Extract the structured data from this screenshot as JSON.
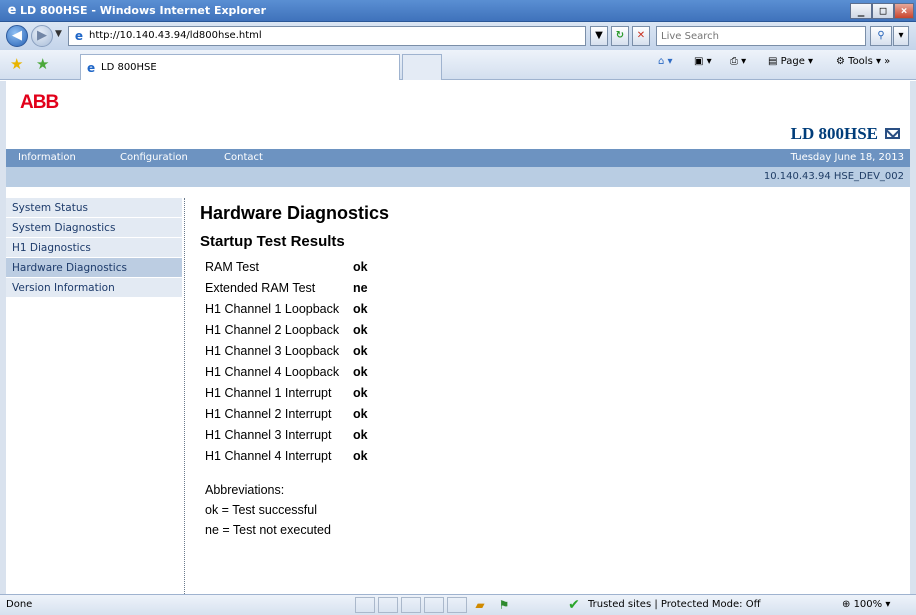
{
  "window": {
    "title": "LD 800HSE - Windows Internet Explorer",
    "minimize_label": "_",
    "maximize_label": "□",
    "close_label": "×"
  },
  "address_bar": {
    "url": "http://10.140.43.94/ld800hse.html",
    "search_placeholder": "Live Search"
  },
  "favorites_bar": {
    "tab_label": "LD 800HSE",
    "page_menu": "Page",
    "tools_menu": "Tools"
  },
  "page": {
    "logo": "ABB",
    "product_title": "LD 800HSE",
    "menu": [
      "Information",
      "Configuration",
      "Contact"
    ],
    "date": "Tuesday June 18, 2013",
    "host_info": "10.140.43.94 HSE_DEV_002",
    "sidebar": [
      {
        "label": "System Status"
      },
      {
        "label": "System Diagnostics"
      },
      {
        "label": "H1 Diagnostics"
      },
      {
        "label": "Hardware Diagnostics",
        "active": true
      },
      {
        "label": "Version Information"
      }
    ],
    "heading": "Hardware Diagnostics",
    "subheading": "Startup Test Results",
    "results": [
      {
        "name": "RAM Test",
        "result": "ok"
      },
      {
        "name": "Extended RAM Test",
        "result": "ne"
      },
      {
        "name": "H1 Channel 1 Loopback",
        "result": "ok"
      },
      {
        "name": "H1 Channel 2 Loopback",
        "result": "ok"
      },
      {
        "name": "H1 Channel 3 Loopback",
        "result": "ok"
      },
      {
        "name": "H1 Channel 4 Loopback",
        "result": "ok"
      },
      {
        "name": "H1 Channel 1 Interrupt",
        "result": "ok"
      },
      {
        "name": "H1 Channel 2 Interrupt",
        "result": "ok"
      },
      {
        "name": "H1 Channel 3 Interrupt",
        "result": "ok"
      },
      {
        "name": "H1 Channel 4 Interrupt",
        "result": "ok"
      }
    ],
    "abbreviations_title": "Abbreviations:",
    "abbreviations": [
      "ok = Test successful",
      "ne = Test not executed"
    ]
  },
  "status_bar": {
    "status": "Done",
    "zone": "Trusted sites | Protected Mode: Off",
    "zoom": "100%"
  },
  "colors": {
    "brand_red": "#e2001a",
    "menu_blue": "#6d93c1",
    "info_blue": "#b9cde3",
    "title_navy": "#003d7a"
  }
}
